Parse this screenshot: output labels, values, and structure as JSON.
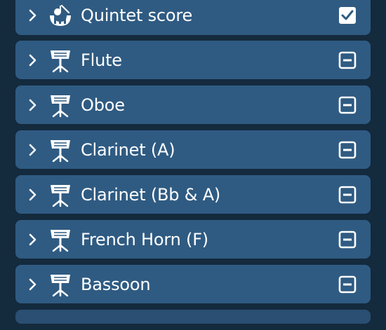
{
  "colors": {
    "background": "#142a3d",
    "row": "#2f5b82",
    "foreground": "#ffffff"
  },
  "rows": [
    {
      "label": "Quintet score",
      "icon": "score-icon",
      "state": "checked"
    },
    {
      "label": "Flute",
      "icon": "music-stand-icon",
      "state": "partial"
    },
    {
      "label": "Oboe",
      "icon": "music-stand-icon",
      "state": "partial"
    },
    {
      "label": "Clarinet (A)",
      "icon": "music-stand-icon",
      "state": "partial"
    },
    {
      "label": "Clarinet (Bb & A)",
      "icon": "music-stand-icon",
      "state": "partial"
    },
    {
      "label": "French Horn (F)",
      "icon": "music-stand-icon",
      "state": "partial"
    },
    {
      "label": "Bassoon",
      "icon": "music-stand-icon",
      "state": "partial"
    }
  ]
}
